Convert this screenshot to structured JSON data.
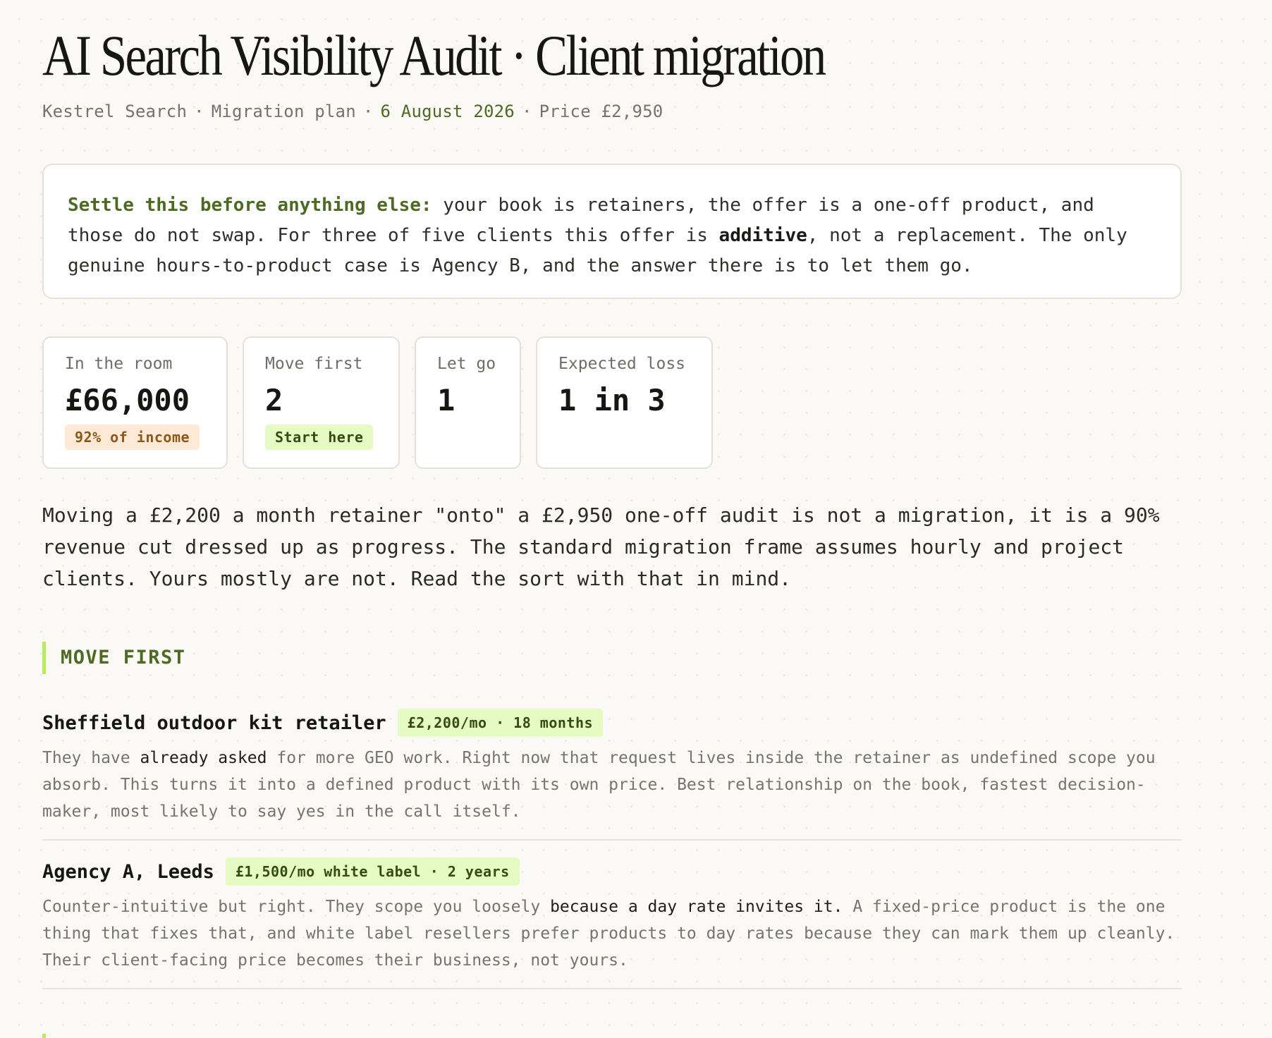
{
  "header": {
    "title": "AI Search Visibility Audit · Client migration",
    "meta_company": "Kestrel Search",
    "meta_doc": "Migration plan",
    "meta_date": "6 August 2026",
    "meta_price": "Price £2,950",
    "separator": "·"
  },
  "callout": {
    "lead": "Settle this before anything else:",
    "text_1": " your book is retainers, the offer is a one-off product, and those do not swap. For three of five clients this offer is ",
    "strong": "additive",
    "text_2": ", not a replacement. The only genuine hours-to-product case is Agency B, and the answer there is to let them go."
  },
  "stats": [
    {
      "label": "In the room",
      "value": "£66,000",
      "badge": "92% of income"
    },
    {
      "label": "Move first",
      "value": "2",
      "badge": "Start here"
    },
    {
      "label": "Let go",
      "value": "1"
    },
    {
      "label": "Expected loss",
      "value": "1 in 3"
    }
  ],
  "intro": "Moving a £2,200 a month retainer \"onto\" a £2,950 one-off audit is not a migration, it is a 90% revenue cut dressed up as progress. The standard migration frame assumes hourly and project clients. Yours mostly are not. Read the sort with that in mind.",
  "section": {
    "title": "MOVE FIRST"
  },
  "items": [
    {
      "name": "Sheffield outdoor kit retailer",
      "badge": "£2,200/mo · 18 months",
      "body_1": "They have ",
      "highlight": "already asked",
      "body_2": " for more GEO work. Right now that request lives inside the retainer as undefined scope you absorb. This turns it into a defined product with its own price. Best relationship on the book, fastest decision-maker, most likely to say yes in the call itself."
    },
    {
      "name": "Agency A, Leeds",
      "badge": "£1,500/mo white label · 2 years",
      "body_1": "Counter-intuitive but right. They scope you loosely ",
      "highlight": "because a day rate invites it.",
      "body_2": " A fixed-price product is the one thing that fixes that, and white label resellers prefer products to day rates because they can mark them up cleanly. Their client-facing price becomes their business, not yours."
    }
  ]
}
